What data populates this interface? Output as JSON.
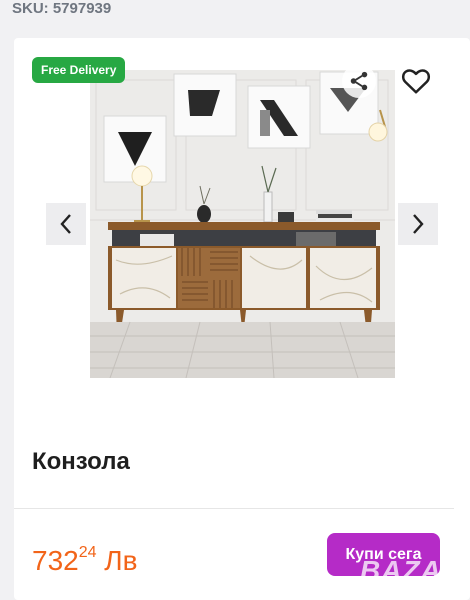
{
  "sku": {
    "label": "SKU: 5797939"
  },
  "badge": {
    "label": "Free Delivery"
  },
  "product": {
    "title": "Конзола",
    "price_whole": "732",
    "price_fraction": "24",
    "currency": "Лв"
  },
  "actions": {
    "buy_label": "Купи сега",
    "share_icon": "share-icon",
    "favorite_icon": "heart-icon",
    "prev_icon": "chevron-left-icon",
    "next_icon": "chevron-right-icon"
  },
  "colors": {
    "price": "#f26419",
    "buy_button": "#b52bc7",
    "badge": "#27a843"
  },
  "watermark": {
    "text": "BAZAR"
  }
}
